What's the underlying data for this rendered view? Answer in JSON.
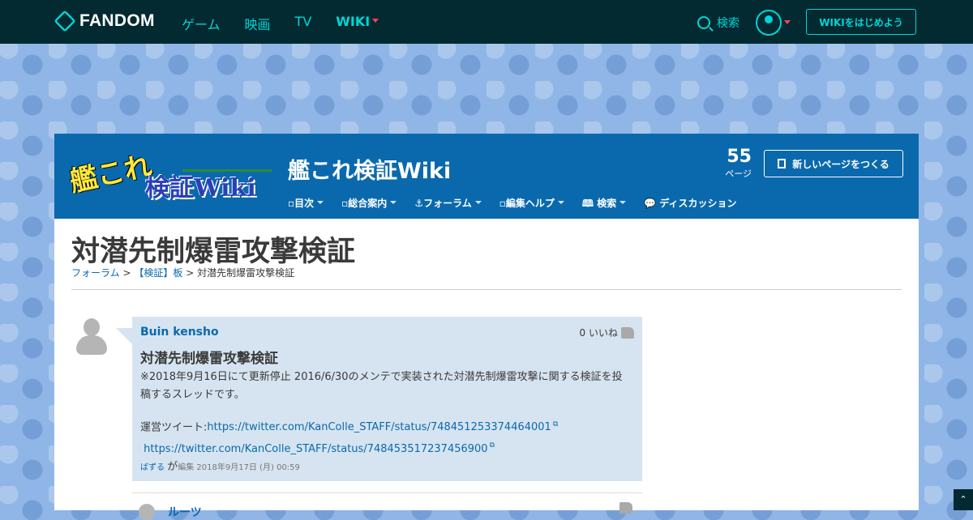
{
  "gnav": {
    "logo": "FANDOM",
    "links": [
      "ゲーム",
      "映画",
      "TV",
      "WIKI"
    ],
    "search_label": "検索",
    "start_wiki": "WIKIをはじめよう"
  },
  "wiki": {
    "logo_line1": "艦これ",
    "logo_line2": "検証Wiki",
    "title": "艦これ検証Wiki",
    "page_count": "55",
    "page_unit": "ページ",
    "new_page": "新しいページをつくる",
    "nav": [
      {
        "icon": "list-icon",
        "label": "目次"
      },
      {
        "icon": "info-icon",
        "label": "総合案内"
      },
      {
        "icon": "anchor-icon",
        "label": "フォーラム"
      },
      {
        "icon": "edit-icon",
        "label": "編集ヘルプ"
      },
      {
        "icon": "book-icon",
        "label": "検索"
      },
      {
        "icon": "chat-icon",
        "label": "ディスカッション"
      }
    ]
  },
  "article": {
    "title": "対潜先制爆雷攻撃検証",
    "breadcrumb": {
      "forum": "フォーラム",
      "sep": ">",
      "board": "【検証】板",
      "current": "対潜先制爆雷攻撃検証"
    }
  },
  "post": {
    "author": "Buin kensho",
    "likes": "0 いいね",
    "title": "対潜先制爆雷攻撃検証",
    "body1": "※2018年9月16日にて更新停止 2016/6/30のメンテで実装された対潜先制爆雷攻撃に関する検証を投稿するスレッドです。",
    "body2_prefix": "運営ツイート:",
    "link1": "https://twitter.com/KanColle_STAFF/status/748451253374464001",
    "link2": "https://twitter.com/KanColle_STAFF/status/748453517237456900",
    "editor": "ばずる",
    "ga": "が",
    "edit_label": "編集",
    "edit_time": "2018年9月17日 (月) 00:59"
  },
  "reply": {
    "author": "ルーツ"
  },
  "colors": {
    "gnav_bg": "#032a31",
    "accent": "#00d6d6",
    "wiki_header": "#0a69ac",
    "post_bg": "#d6e4f1"
  }
}
